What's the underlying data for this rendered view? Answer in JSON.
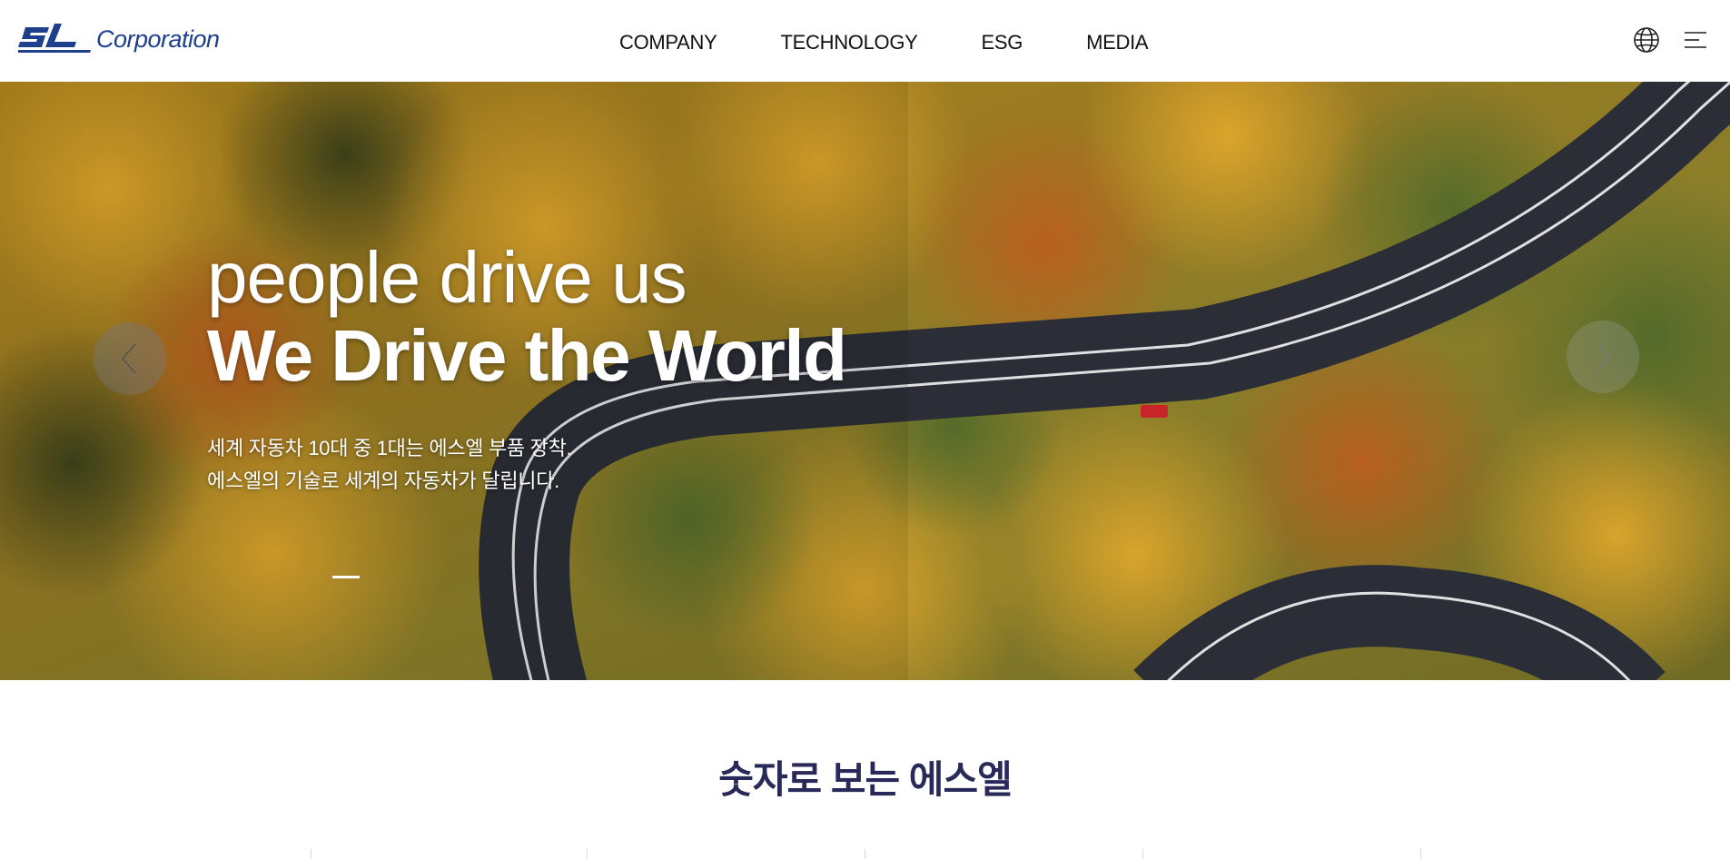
{
  "header": {
    "logo": {
      "mark": "SL",
      "text": "Corporation"
    },
    "nav": [
      {
        "label": "COMPANY"
      },
      {
        "label": "TECHNOLOGY"
      },
      {
        "label": "ESG"
      },
      {
        "label": "MEDIA"
      }
    ],
    "icons": [
      "globe-icon",
      "menu-icon"
    ]
  },
  "hero": {
    "line1": "people drive us",
    "line2": "We Drive the World",
    "desc1": "세계 자동차 10대 중 1대는 에스엘 부품 장착.",
    "desc2": "에스엘의 기술로 세계의 자동차가 달립니다.",
    "image": "aerial autumn forest with winding road",
    "arrows": [
      "chevron-left-icon",
      "chevron-right-icon"
    ]
  },
  "stats": {
    "title": "숫자로 보는 에스엘"
  },
  "colors": {
    "brand": "#1e3f8b",
    "title": "#2a2a5a"
  }
}
